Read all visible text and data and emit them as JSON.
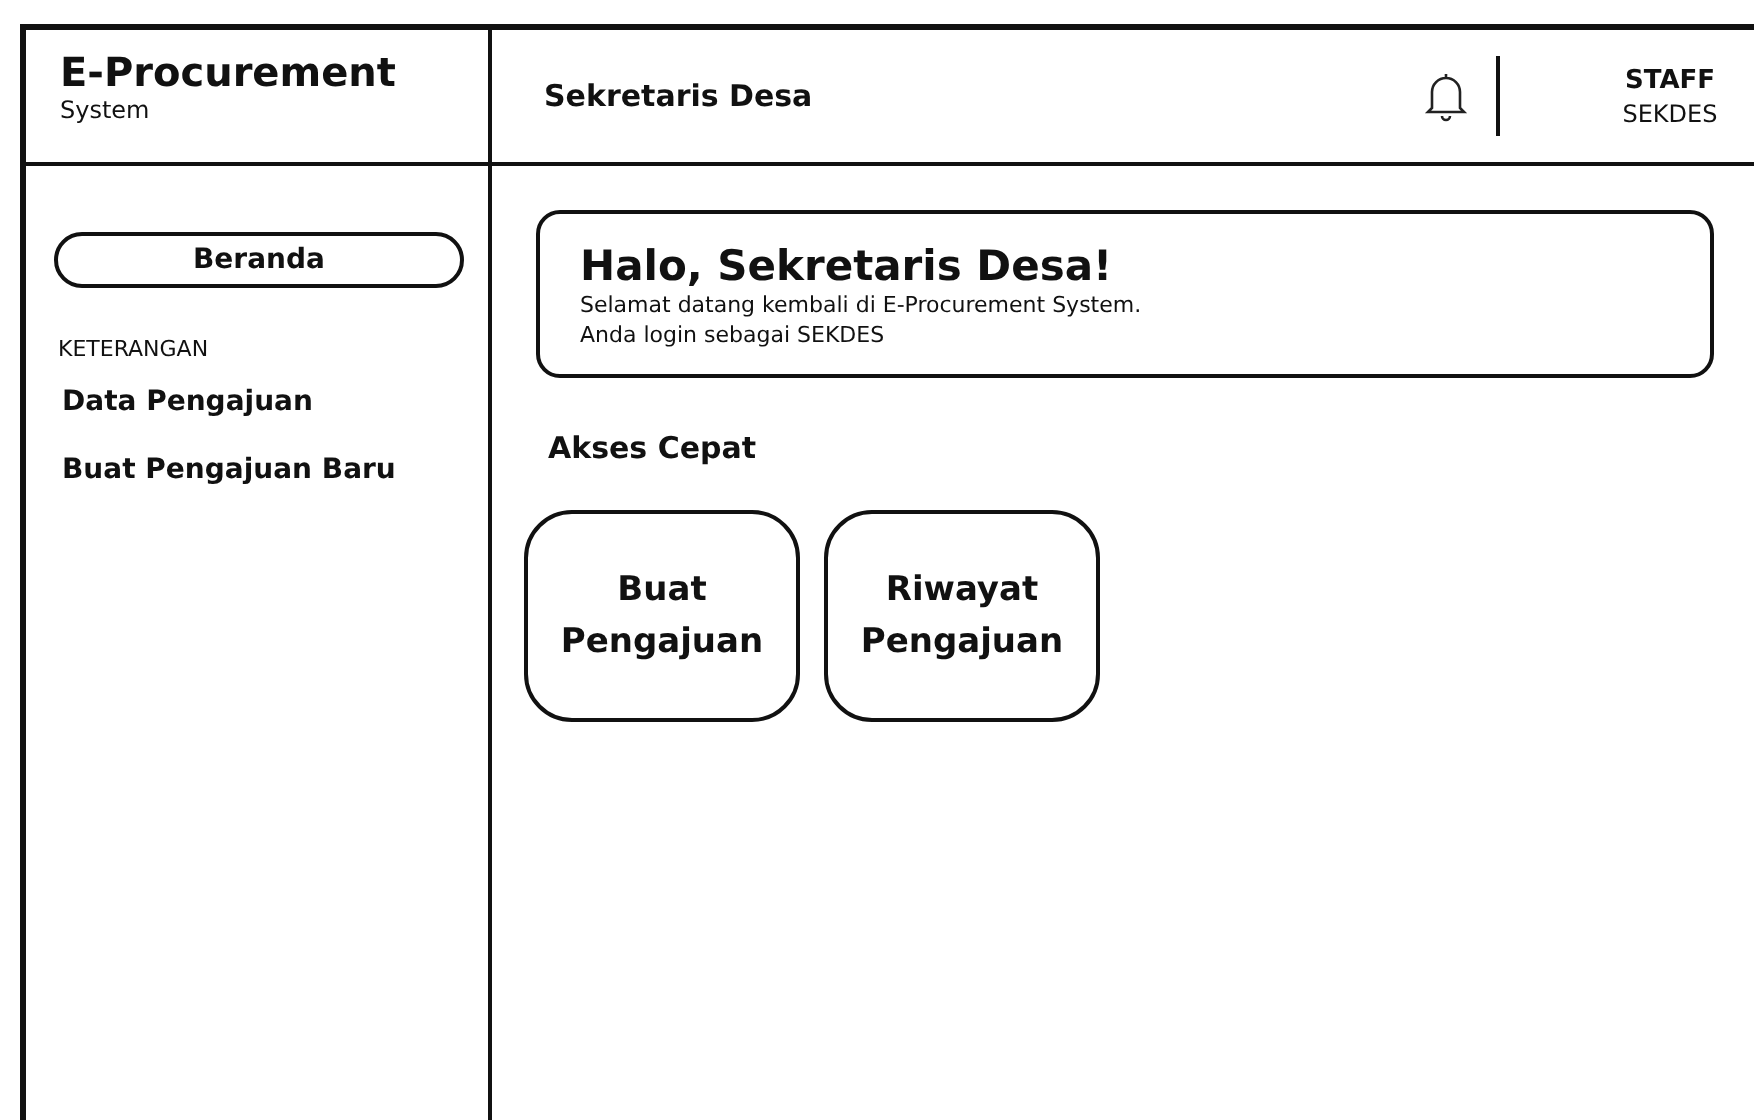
{
  "brand": {
    "title": "E-Procurement",
    "subtitle": "System"
  },
  "header": {
    "page_title": "Sekretaris Desa",
    "role": "STAFF",
    "user": "SEKDES"
  },
  "sidebar": {
    "items": [
      {
        "label": "Beranda",
        "kind": "nav",
        "selected": true
      },
      {
        "label": "KETERANGAN",
        "kind": "section"
      },
      {
        "label": "Data Pengajuan",
        "kind": "nav",
        "selected": false
      },
      {
        "label": "Buat Pengajuan Baru",
        "kind": "nav",
        "selected": false
      }
    ]
  },
  "welcome": {
    "title": "Halo, Sekretaris Desa!",
    "lines": [
      "Selamat datang kembali di E-Procurement System.",
      "Anda login sebagai SEKDES"
    ]
  },
  "quick_access": {
    "title": "Akses Cepat",
    "items": [
      {
        "lines": [
          "Buat",
          "Pengajuan"
        ]
      },
      {
        "lines": [
          "Riwayat",
          "Pengajuan"
        ]
      }
    ]
  }
}
